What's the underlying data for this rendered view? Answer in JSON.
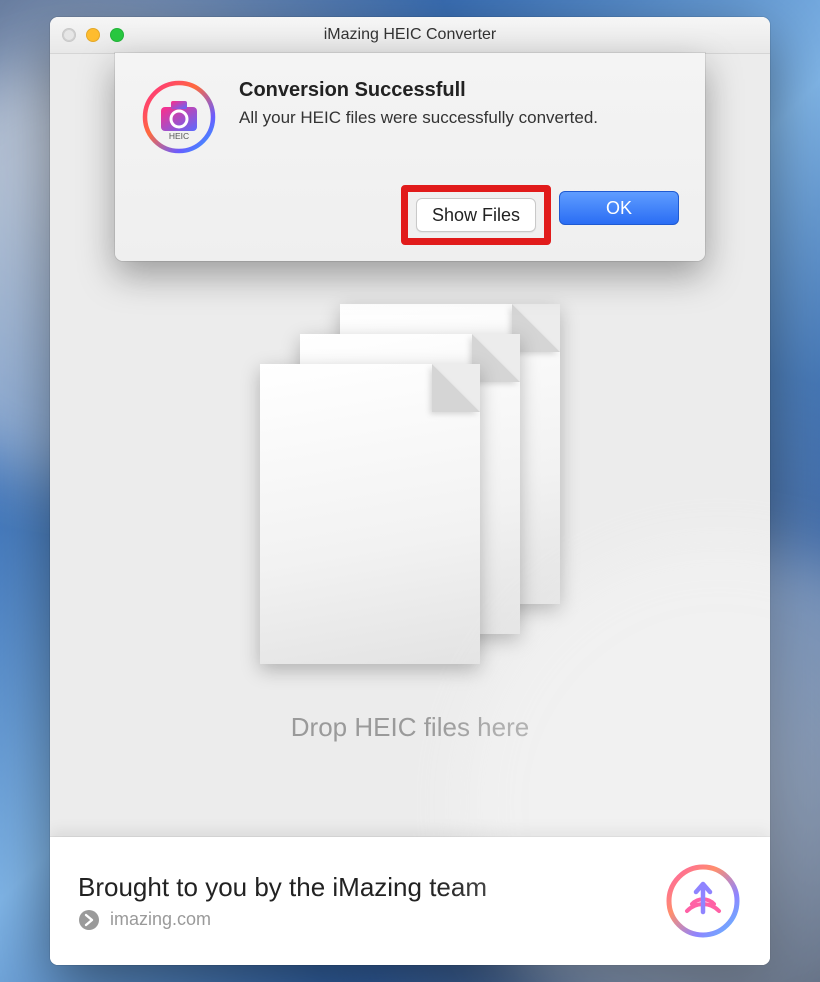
{
  "window": {
    "title": "iMazing HEIC Converter"
  },
  "dialog": {
    "title": "Conversion Successfull",
    "message": "All your HEIC files were successfully converted.",
    "show_files_label": "Show Files",
    "ok_label": "OK",
    "icon_label": "HEIC"
  },
  "main": {
    "drop_hint": "Drop HEIC files here"
  },
  "footer": {
    "tagline": "Brought to you by the iMazing team",
    "link_text": "imazing.com"
  },
  "colors": {
    "highlight": "#e11b1b",
    "primary_button": "#2a6df4"
  }
}
